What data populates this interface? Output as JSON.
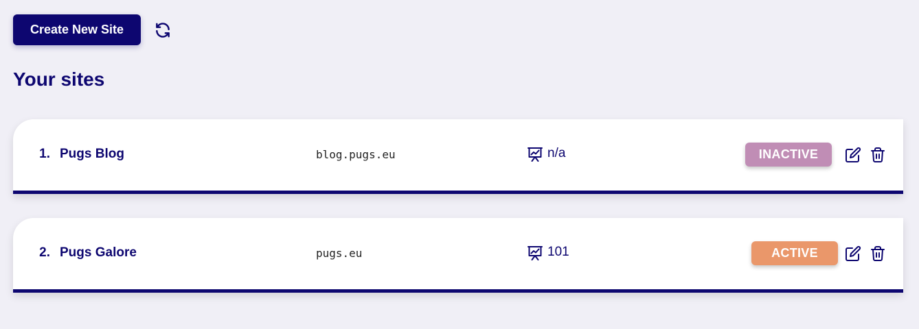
{
  "toolbar": {
    "create_label": "Create New Site",
    "refresh_icon": "refresh-icon"
  },
  "page_title": "Your sites",
  "colors": {
    "primary": "#0d0670",
    "background": "#f0eff6",
    "inactive_badge": "#c08db5",
    "active_badge": "#ea976a"
  },
  "sites": [
    {
      "index": "1.",
      "name": "Pugs Blog",
      "domain": "blog.pugs.eu",
      "stats_icon": "presentation-chart-icon",
      "stats": "n/a",
      "status": "INACTIVE",
      "edit_icon": "edit-icon",
      "delete_icon": "trash-icon"
    },
    {
      "index": "2.",
      "name": "Pugs Galore",
      "domain": "pugs.eu",
      "stats_icon": "presentation-chart-icon",
      "stats": "101",
      "status": "ACTIVE",
      "edit_icon": "edit-icon",
      "delete_icon": "trash-icon"
    }
  ]
}
